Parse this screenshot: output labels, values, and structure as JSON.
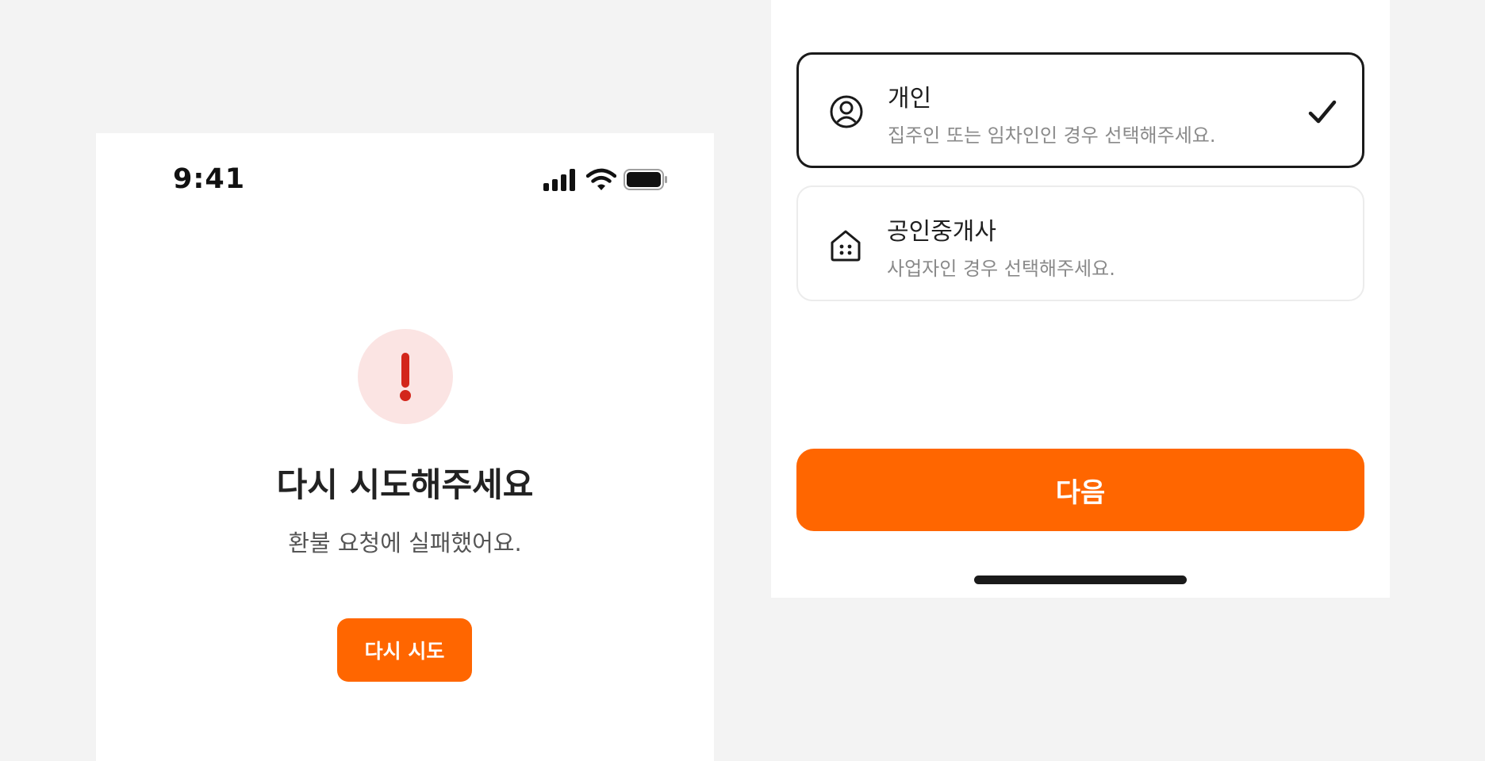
{
  "left_screen": {
    "status_bar": {
      "time": "9:41",
      "icons": [
        "cellular-signal-icon",
        "wifi-icon",
        "battery-icon"
      ]
    },
    "error": {
      "icon": "exclamation-icon",
      "title": "다시 시도해주세요",
      "description": "환불 요청에 실패했어요.",
      "retry_label": "다시 시도"
    }
  },
  "right_screen": {
    "options": [
      {
        "title": "개인",
        "description": "집주인 또는 임차인인 경우 선택해주세요.",
        "icon": "user-circle-icon",
        "selected": true
      },
      {
        "title": "공인중개사",
        "description": "사업자인 경우 선택해주세요.",
        "icon": "building-icon",
        "selected": false
      }
    ],
    "next_label": "다음"
  },
  "colors": {
    "accent": "#ff6600",
    "error_badge_bg": "#fbe4e3",
    "error_icon": "#d3261b",
    "background": "#f3f3f3"
  }
}
